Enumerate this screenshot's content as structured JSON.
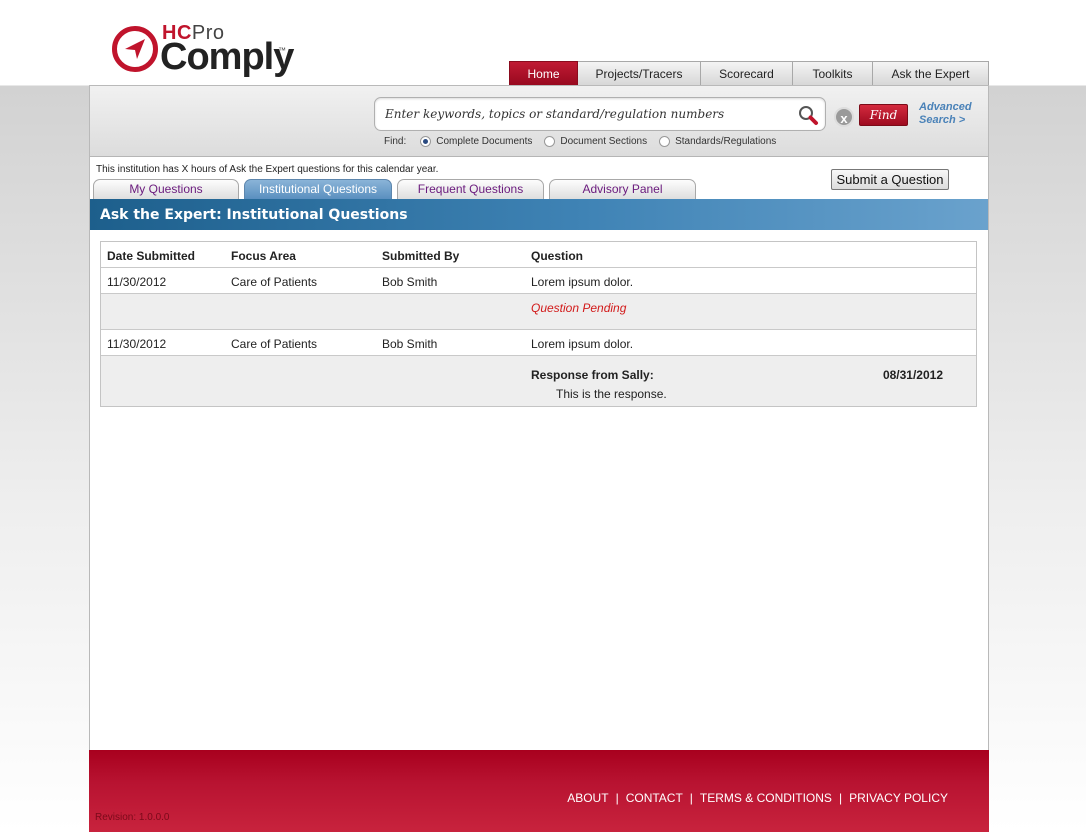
{
  "brand": {
    "hc": "HC",
    "pro": "Pro",
    "name": "Comply",
    "tm": "™"
  },
  "topnav": [
    {
      "label": "Home",
      "active": true
    },
    {
      "label": "Projects/Tracers"
    },
    {
      "label": "Scorecard"
    },
    {
      "label": "Toolkits"
    },
    {
      "label": "Ask the Expert"
    }
  ],
  "search": {
    "placeholder": "Enter keywords, topics or standard/regulation numbers",
    "find_label": "Find",
    "clear_glyph": "x",
    "advanced_line1": "Advanced",
    "advanced_line2": "Search >",
    "find_prefix": "Find:",
    "options": [
      {
        "label": "Complete Documents",
        "checked": true
      },
      {
        "label": "Document Sections",
        "checked": false
      },
      {
        "label": "Standards/Regulations",
        "checked": false
      }
    ]
  },
  "notice": "This institution has X hours of Ask the Expert questions for this calendar year.",
  "subtabs": [
    {
      "label": "My Questions"
    },
    {
      "label": "Institutional Questions",
      "active": true
    },
    {
      "label": "Frequent Questions"
    },
    {
      "label": "Advisory Panel"
    }
  ],
  "submit_label": "Submit a Question",
  "page_title": "Ask the Expert: Institutional Questions",
  "table": {
    "headers": [
      "Date Submitted",
      "Focus Area",
      "Submitted By",
      "Question"
    ],
    "rows": [
      {
        "date": "11/30/2012",
        "focus": "Care of Patients",
        "by": "Bob Smith",
        "question": "Lorem ipsum dolor.",
        "status": "Question Pending"
      },
      {
        "date": "11/30/2012",
        "focus": "Care of Patients",
        "by": "Bob Smith",
        "question": "Lorem ipsum dolor.",
        "response_label": "Response from Sally:",
        "response_date": "08/31/2012",
        "response_text": "This is the response."
      }
    ]
  },
  "footer": {
    "links": [
      "ABOUT",
      "CONTACT",
      "TERMS & CONDITIONS",
      "PRIVACY POLICY"
    ],
    "separator": "|",
    "revision": "Revision: 1.0.0.0"
  },
  "colors": {
    "brand_red": "#a8001e",
    "title_blue": "#1d5f8c",
    "pending_red": "#d21a1a",
    "link_blue": "#4a82b8"
  }
}
